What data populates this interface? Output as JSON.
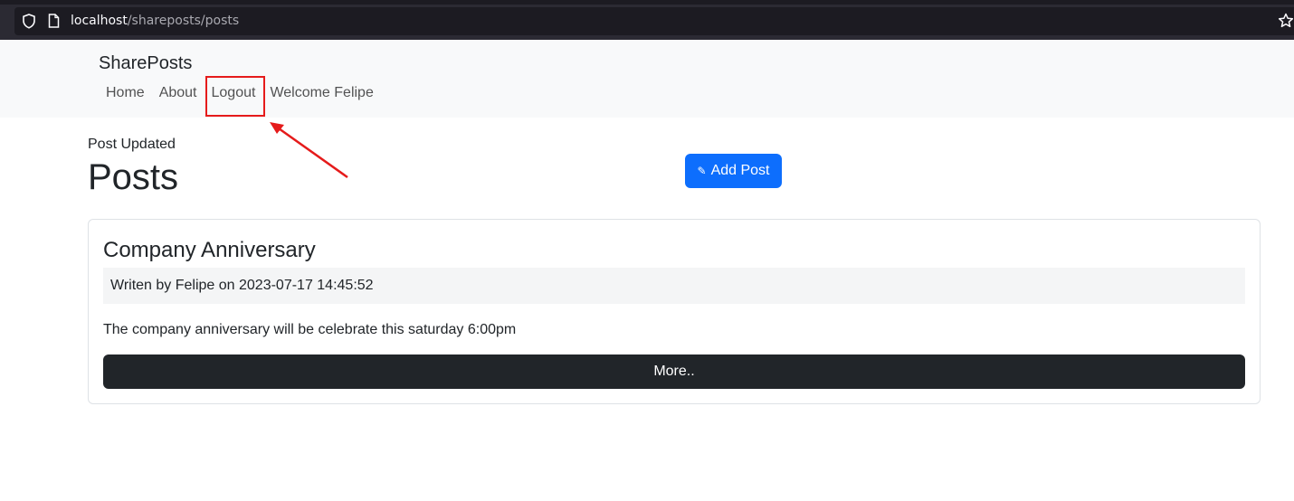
{
  "browser": {
    "url_host": "localhost",
    "url_path": "/shareposts/posts"
  },
  "navbar": {
    "brand": "SharePosts",
    "links": [
      {
        "label": "Home"
      },
      {
        "label": "About"
      },
      {
        "label": "Logout"
      },
      {
        "label": "Welcome Felipe"
      }
    ]
  },
  "flash_message": "Post Updated",
  "page_title": "Posts",
  "add_post_button": {
    "icon": "pencil-icon",
    "label": "Add Post"
  },
  "posts": [
    {
      "title": "Company Anniversary",
      "meta": "Writen by Felipe on 2023-07-17 14:45:52",
      "body": "The company anniversary will be celebrate this saturday 6:00pm",
      "more_label": "More.."
    }
  ],
  "colors": {
    "primary": "#0d6efd",
    "dark": "#212529",
    "annotation": "#e51b1b"
  }
}
